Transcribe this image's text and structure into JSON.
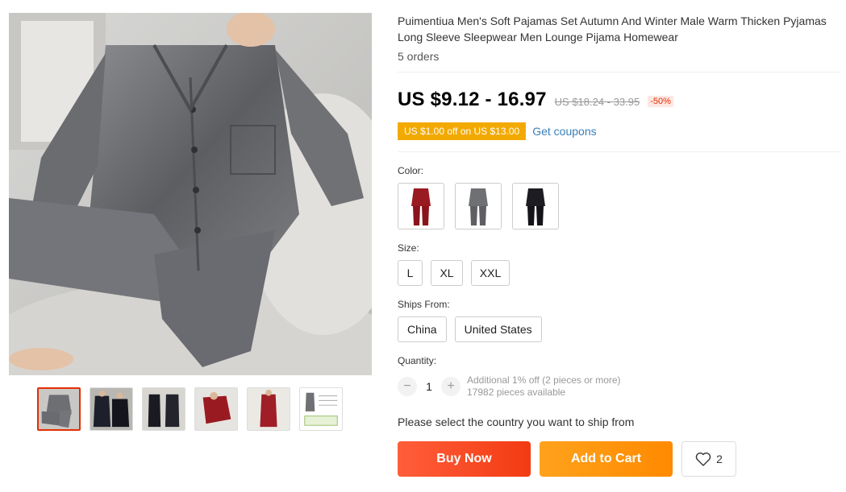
{
  "product": {
    "title": "Puimentiua Men's Soft Pajamas Set Autumn And Winter Male Warm Thicken Pyjamas Long Sleeve Sleepwear Men Lounge Pijama Homewear",
    "orders": "5 orders",
    "price": "US $9.12 - 16.97",
    "original_price": "US $18.24 - 33.95",
    "discount": "-50%"
  },
  "coupon": {
    "tag": "US $1.00 off on US $13.00",
    "link": "Get coupons"
  },
  "color": {
    "label": "Color:",
    "options": [
      {
        "name": "red",
        "swatch": "#9a1a22"
      },
      {
        "name": "gray",
        "swatch": "#6f7073"
      },
      {
        "name": "black",
        "swatch": "#1c1c22"
      }
    ]
  },
  "size": {
    "label": "Size:",
    "options": [
      "L",
      "XL",
      "XXL"
    ]
  },
  "ships_from": {
    "label": "Ships From:",
    "options": [
      "China",
      "United States"
    ]
  },
  "quantity": {
    "label": "Quantity:",
    "minus": "−",
    "plus": "+",
    "value": "1",
    "note_line1": "Additional 1% off (2 pieces or more)",
    "note_line2": "17982 pieces available"
  },
  "ship_country_note": "Please select the country you want to ship from",
  "actions": {
    "buy_now": "Buy Now",
    "add_to_cart": "Add to Cart",
    "wishlist_count": "2"
  },
  "gallery": {
    "thumbnails": [
      "gray-velvet-seated",
      "navy-pair",
      "black-standing",
      "red-on-bed",
      "red-standing",
      "size-chart"
    ],
    "active_index": 0
  },
  "colors": {
    "price_red": "#e62e04",
    "coupon_orange": "#f2a900",
    "link_blue": "#3a7fb8",
    "buy_now": "#f23b13",
    "add_to_cart": "#ff8a00"
  }
}
